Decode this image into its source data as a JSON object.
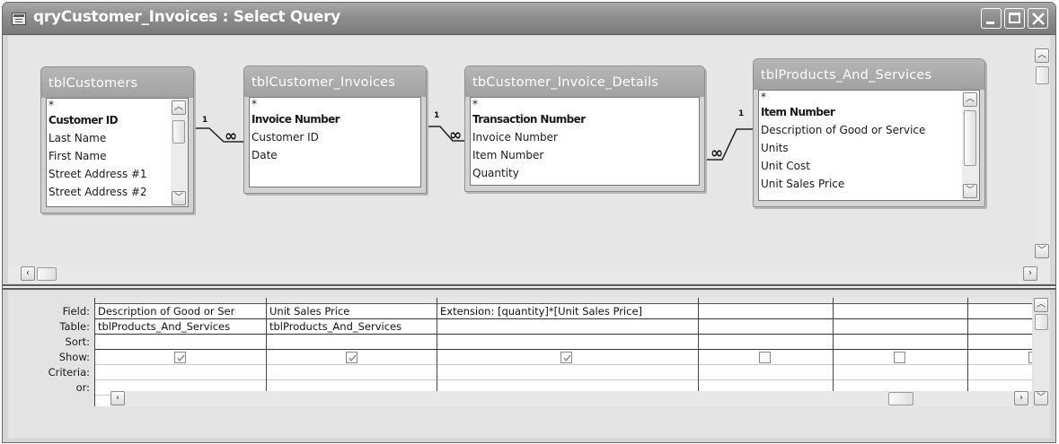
{
  "window": {
    "title": "qryCustomer_Invoices : Select Query"
  },
  "icons": {
    "window_icon": "query-window-icon",
    "minimize": "minimize-icon",
    "maximize": "maximize-icon",
    "close": "close-icon"
  },
  "tables": [
    {
      "name": "tblCustomers",
      "fields": [
        "*",
        "Customer ID",
        "Last Name",
        "First Name",
        "Street Address #1",
        "Street Address #2"
      ],
      "key_field": "Customer ID"
    },
    {
      "name": "tblCustomer_Invoices",
      "fields": [
        "*",
        "Invoice Number",
        "Customer ID",
        "Date"
      ],
      "key_field": "Invoice Number"
    },
    {
      "name": "tbCustomer_Invoice_Details",
      "fields": [
        "*",
        "Transaction Number",
        "Invoice Number",
        "Item Number",
        "Quantity"
      ],
      "key_field": "Transaction Number"
    },
    {
      "name": "tblProducts_And_Services",
      "fields": [
        "*",
        "Item Number",
        "Description of Good or Service",
        "Units",
        "Unit Cost",
        "Unit Sales Price"
      ],
      "key_field": "Item Number"
    }
  ],
  "relationships": [
    {
      "one": "1",
      "many": "∞"
    },
    {
      "one": "1",
      "many": "∞"
    },
    {
      "one": "1",
      "many": "∞"
    }
  ],
  "grid": {
    "row_labels": [
      "Field:",
      "Table:",
      "Sort:",
      "Show:",
      "Criteria:",
      "or:"
    ],
    "columns": [
      {
        "field": "Description of Good or Ser",
        "table": "tblProducts_And_Services",
        "sort": "",
        "show": true,
        "criteria": "",
        "or": ""
      },
      {
        "field": "Unit Sales Price",
        "table": "tblProducts_And_Services",
        "sort": "",
        "show": true,
        "criteria": "",
        "or": ""
      },
      {
        "field": "Extension: [quantity]*[Unit Sales Price]",
        "table": "",
        "sort": "",
        "show": true,
        "criteria": "",
        "or": ""
      },
      {
        "field": "",
        "table": "",
        "sort": "",
        "show": false,
        "criteria": "",
        "or": ""
      },
      {
        "field": "",
        "table": "",
        "sort": "",
        "show": false,
        "criteria": "",
        "or": ""
      },
      {
        "field": "",
        "table": "",
        "sort": "",
        "show": false,
        "criteria": "",
        "or": ""
      }
    ]
  }
}
